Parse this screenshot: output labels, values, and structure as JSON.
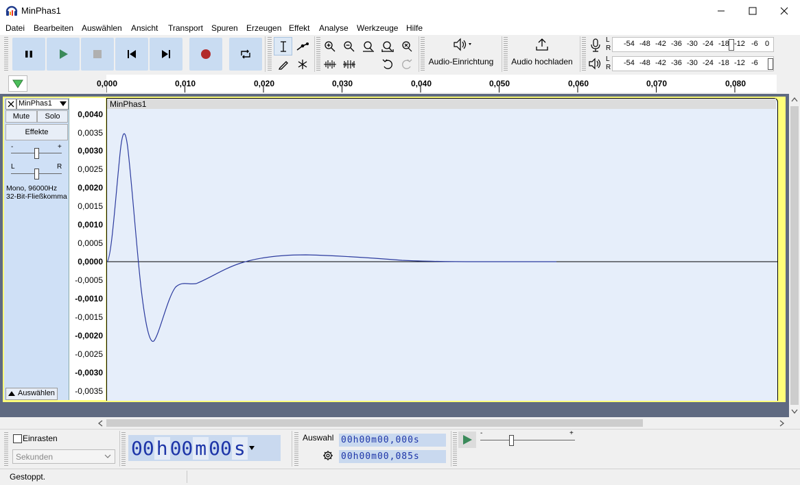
{
  "window": {
    "title": "MinPhas1"
  },
  "menu": [
    "Datei",
    "Bearbeiten",
    "Auswählen",
    "Ansicht",
    "Transport",
    "Spuren",
    "Erzeugen",
    "Effekt",
    "Analyse",
    "Werkzeuge",
    "Hilfe"
  ],
  "toolbar": {
    "audio_setup_label": "Audio-Einrichtung",
    "upload_label": "Audio hochladen",
    "meter_ticks": [
      "-54",
      "-48",
      "-42",
      "-36",
      "-30",
      "-24",
      "-18",
      "-12",
      "-6",
      "0"
    ],
    "meter_L": "L",
    "meter_R": "R"
  },
  "ruler": {
    "ticks": [
      "0,000",
      "0,010",
      "0,020",
      "0,030",
      "0,040",
      "0,050",
      "0,060",
      "0,070",
      "0,080"
    ]
  },
  "track": {
    "name": "MinPhas1",
    "mute_label": "Mute",
    "solo_label": "Solo",
    "effects_label": "Effekte",
    "gain_minus": "-",
    "gain_plus": "+",
    "pan_left": "L",
    "pan_right": "R",
    "info_rate": "Mono, 96000Hz",
    "info_format": "32-Bit-Fließkomma",
    "select_label": "Auswählen",
    "clip_title": "MinPhas1",
    "y_labels": [
      "0,0040",
      "0,0035",
      "0,0030",
      "0,0025",
      "0,0020",
      "0,0015",
      "0,0010",
      "0,0005",
      "0,0000",
      "-0,0005",
      "-0,0010",
      "-0,0015",
      "-0,0020",
      "-0,0025",
      "-0,0030",
      "-0,0035"
    ],
    "wave_color": "#2b3a9e"
  },
  "bottom": {
    "snap_label": "Einrasten",
    "snap_unit": "Sekunden",
    "position_time": {
      "hh": "00",
      "h": "h",
      "mm": "00",
      "m": "m",
      "ss": "00",
      "s": "s"
    },
    "selection_label": "Auswahl",
    "sel_start": "00h00m00,000s",
    "sel_end": "00h00m00,085s",
    "play_speed_minus": "-",
    "play_speed_plus": "+"
  },
  "status": {
    "text": "Gestoppt."
  }
}
